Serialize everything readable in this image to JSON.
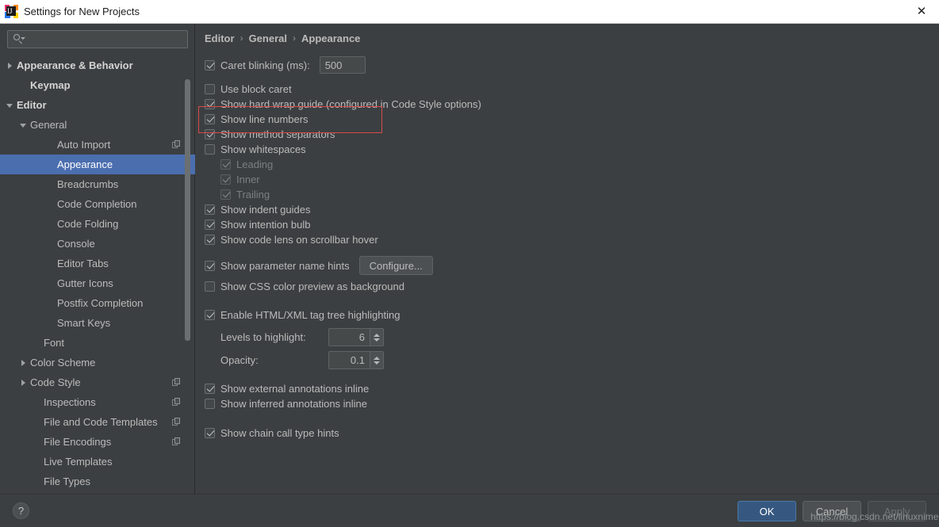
{
  "window": {
    "title": "Settings for New Projects",
    "logo_text": "IJ",
    "close_icon": "✕"
  },
  "sidebar": {
    "search": {
      "value": "",
      "placeholder": ""
    },
    "items": [
      {
        "label": "Appearance & Behavior",
        "indent": 0,
        "twisty": "collapsed",
        "bold": true,
        "selected": false,
        "copy": false
      },
      {
        "label": "Keymap",
        "indent": 1,
        "twisty": "none",
        "bold": true,
        "selected": false,
        "copy": false
      },
      {
        "label": "Editor",
        "indent": 0,
        "twisty": "expanded",
        "bold": true,
        "selected": false,
        "copy": false
      },
      {
        "label": "General",
        "indent": 1,
        "twisty": "expanded",
        "bold": false,
        "selected": false,
        "copy": false
      },
      {
        "label": "Auto Import",
        "indent": 3,
        "twisty": "none",
        "bold": false,
        "selected": false,
        "copy": true
      },
      {
        "label": "Appearance",
        "indent": 3,
        "twisty": "none",
        "bold": false,
        "selected": true,
        "copy": false
      },
      {
        "label": "Breadcrumbs",
        "indent": 3,
        "twisty": "none",
        "bold": false,
        "selected": false,
        "copy": false
      },
      {
        "label": "Code Completion",
        "indent": 3,
        "twisty": "none",
        "bold": false,
        "selected": false,
        "copy": false
      },
      {
        "label": "Code Folding",
        "indent": 3,
        "twisty": "none",
        "bold": false,
        "selected": false,
        "copy": false
      },
      {
        "label": "Console",
        "indent": 3,
        "twisty": "none",
        "bold": false,
        "selected": false,
        "copy": false
      },
      {
        "label": "Editor Tabs",
        "indent": 3,
        "twisty": "none",
        "bold": false,
        "selected": false,
        "copy": false
      },
      {
        "label": "Gutter Icons",
        "indent": 3,
        "twisty": "none",
        "bold": false,
        "selected": false,
        "copy": false
      },
      {
        "label": "Postfix Completion",
        "indent": 3,
        "twisty": "none",
        "bold": false,
        "selected": false,
        "copy": false
      },
      {
        "label": "Smart Keys",
        "indent": 3,
        "twisty": "none",
        "bold": false,
        "selected": false,
        "copy": false
      },
      {
        "label": "Font",
        "indent": 2,
        "twisty": "none",
        "bold": false,
        "selected": false,
        "copy": false
      },
      {
        "label": "Color Scheme",
        "indent": 1,
        "twisty": "collapsed",
        "bold": false,
        "selected": false,
        "copy": false
      },
      {
        "label": "Code Style",
        "indent": 1,
        "twisty": "collapsed",
        "bold": false,
        "selected": false,
        "copy": true
      },
      {
        "label": "Inspections",
        "indent": 2,
        "twisty": "none",
        "bold": false,
        "selected": false,
        "copy": true
      },
      {
        "label": "File and Code Templates",
        "indent": 2,
        "twisty": "none",
        "bold": false,
        "selected": false,
        "copy": true
      },
      {
        "label": "File Encodings",
        "indent": 2,
        "twisty": "none",
        "bold": false,
        "selected": false,
        "copy": true
      },
      {
        "label": "Live Templates",
        "indent": 2,
        "twisty": "none",
        "bold": false,
        "selected": false,
        "copy": false
      },
      {
        "label": "File Types",
        "indent": 2,
        "twisty": "none",
        "bold": false,
        "selected": false,
        "copy": false
      }
    ]
  },
  "breadcrumb": {
    "level1": "Editor",
    "sep1": "›",
    "level2": "General",
    "sep2": "›",
    "level3": "Appearance"
  },
  "main": {
    "caret_blinking_label": "Caret blinking (ms):",
    "caret_blinking_value": "500",
    "use_block_caret": "Use block caret",
    "show_hard_wrap_guide": "Show hard wrap guide (configured in Code Style options)",
    "show_line_numbers": "Show line numbers",
    "show_method_separators": "Show method separators",
    "show_whitespaces": "Show whitespaces",
    "leading": "Leading",
    "inner": "Inner",
    "trailing": "Trailing",
    "show_indent_guides": "Show indent guides",
    "show_intention_bulb": "Show intention bulb",
    "show_code_lens": "Show code lens on scrollbar hover",
    "show_parameter_name_hints": "Show parameter name hints",
    "configure_button": "Configure...",
    "show_css_color_preview": "Show CSS color preview as background",
    "enable_html_xml": "Enable HTML/XML tag tree highlighting",
    "levels_label": "Levels to highlight:",
    "levels_value": "6",
    "opacity_label": "Opacity:",
    "opacity_value": "0.1",
    "show_external_annotations": "Show external annotations inline",
    "show_inferred_annotations": "Show inferred annotations inline",
    "show_chain_call_hints": "Show chain call type hints"
  },
  "footer": {
    "help": "?",
    "ok": "OK",
    "cancel": "Cancel",
    "apply": "Apply"
  },
  "watermark": "https://blog.csdn.net/linuxnimei",
  "colors": {
    "panel_bg": "#3c3f41",
    "selection_blue": "#4b6eaf",
    "primary_button": "#365880",
    "annotation_red": "#d94a4a",
    "text": "#bbbbbb"
  }
}
